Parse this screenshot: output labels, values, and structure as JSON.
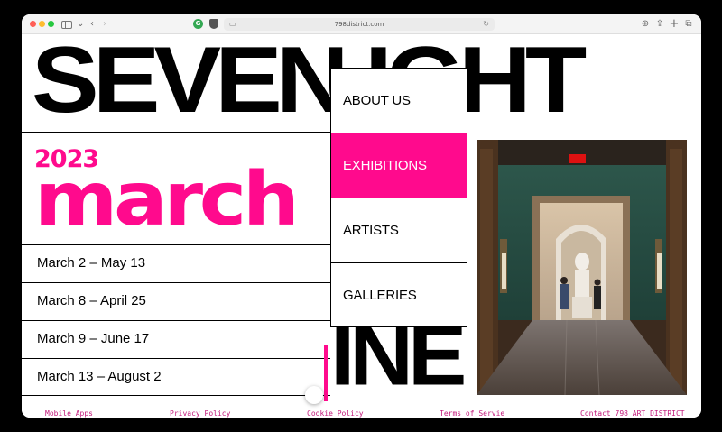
{
  "browser": {
    "url": "798district.com"
  },
  "hero": {
    "top_text": "SEVEN IGHT",
    "bottom_text": "INE"
  },
  "event": {
    "year": "2023",
    "month": "march",
    "dates": [
      "March 2  –  May 13",
      "March 8  –  April 25",
      "March 9  –  June 17",
      "March 13  –  August 2"
    ]
  },
  "nav": {
    "items": [
      "ABOUT US",
      "EXHIBITIONS",
      "ARTISTS",
      "GALLERIES"
    ],
    "active": "EXHIBITIONS"
  },
  "footer": {
    "links": [
      "Mobile Apps",
      "Privacy Policy",
      "Cookie Policy",
      "Terms of Servie",
      "Contact 798 ART DISTRICT"
    ]
  },
  "colors": {
    "accent": "#ff0a8d",
    "footer_link": "#c2187a"
  }
}
